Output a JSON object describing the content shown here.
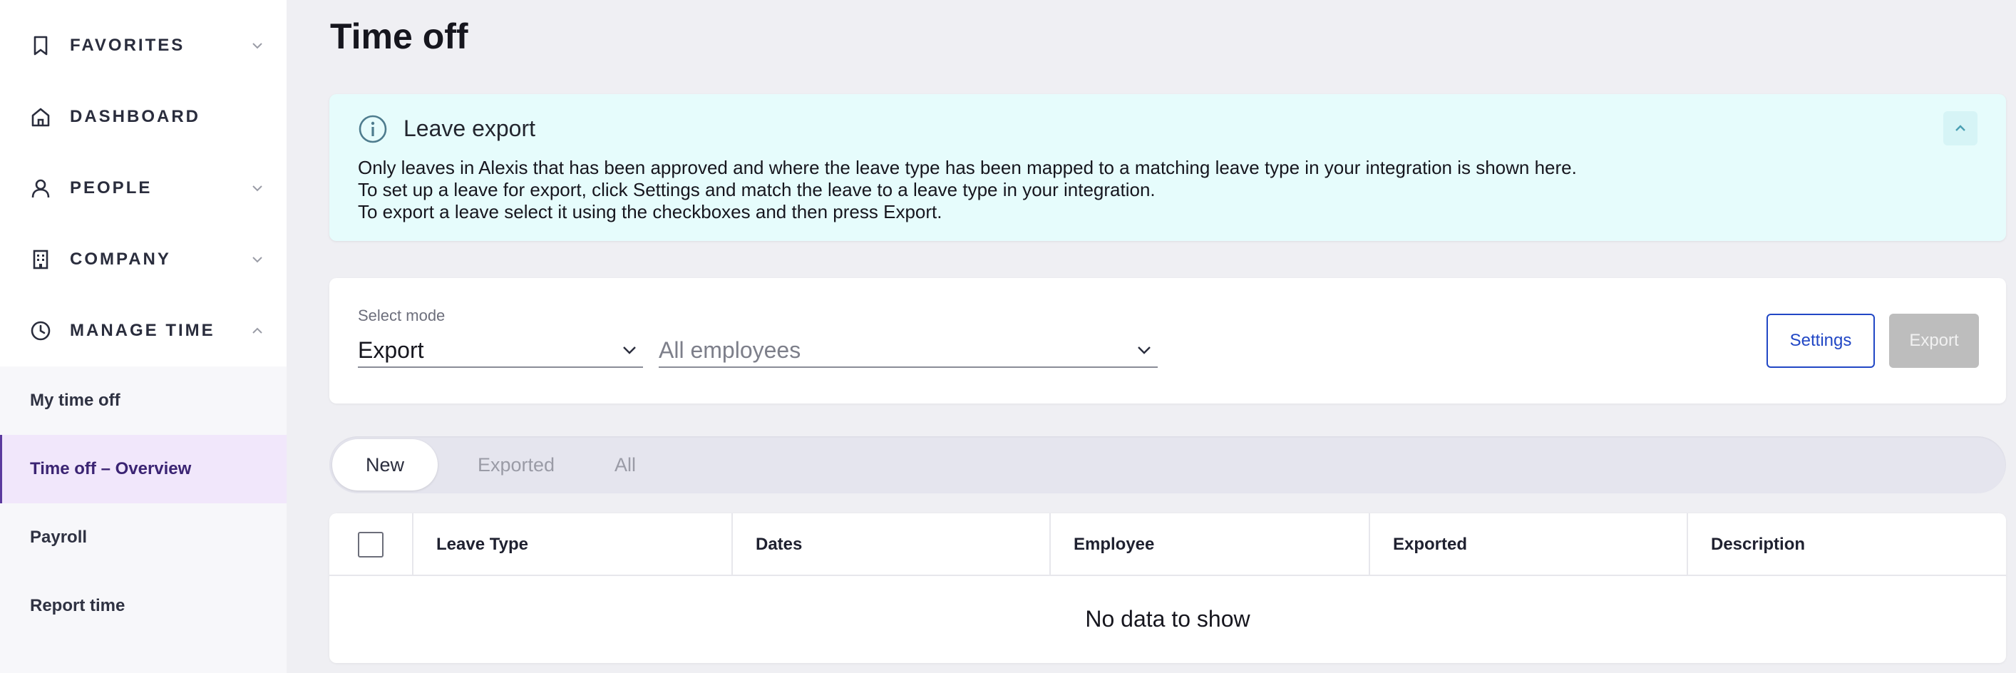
{
  "sidebar": {
    "groups": [
      {
        "label": "FAVORITES",
        "icon": "bookmark-icon",
        "chevron": "down"
      },
      {
        "label": "DASHBOARD",
        "icon": "home-icon",
        "chevron": "none"
      },
      {
        "label": "PEOPLE",
        "icon": "person-icon",
        "chevron": "down"
      },
      {
        "label": "COMPANY",
        "icon": "building-icon",
        "chevron": "down"
      },
      {
        "label": "MANAGE TIME",
        "icon": "clock-icon",
        "chevron": "up"
      }
    ],
    "subitems": [
      {
        "label": "My time off",
        "active": false
      },
      {
        "label": "Time off – Overview",
        "active": true
      },
      {
        "label": "Payroll",
        "active": false
      },
      {
        "label": "Report time",
        "active": false
      }
    ]
  },
  "page": {
    "title": "Time off"
  },
  "info": {
    "title": "Leave export",
    "icon": "info-icon",
    "lines": [
      "Only leaves in Alexis that has been approved and where the leave type has been mapped to a matching leave type in your integration is shown here.",
      "To set up a leave for export, click Settings and match the leave to a leave type in your integration.",
      "To export a leave select it using the checkboxes and then press Export."
    ]
  },
  "filters": {
    "mode_label": "Select mode",
    "mode_value": "Export",
    "employees_value": "All employees",
    "settings_label": "Settings",
    "export_label": "Export"
  },
  "tabs": [
    {
      "label": "New",
      "active": true
    },
    {
      "label": "Exported",
      "active": false
    },
    {
      "label": "All",
      "active": false
    }
  ],
  "table": {
    "columns": [
      "Leave Type",
      "Dates",
      "Employee",
      "Exported",
      "Description"
    ],
    "empty_text": "No data to show"
  },
  "colors": {
    "accent": "#2147c5",
    "active_nav_bg": "#f1e7fb",
    "active_nav_text": "#3b2473",
    "info_bg": "#e6fcfc",
    "disabled_button": "#bdbdbd"
  }
}
